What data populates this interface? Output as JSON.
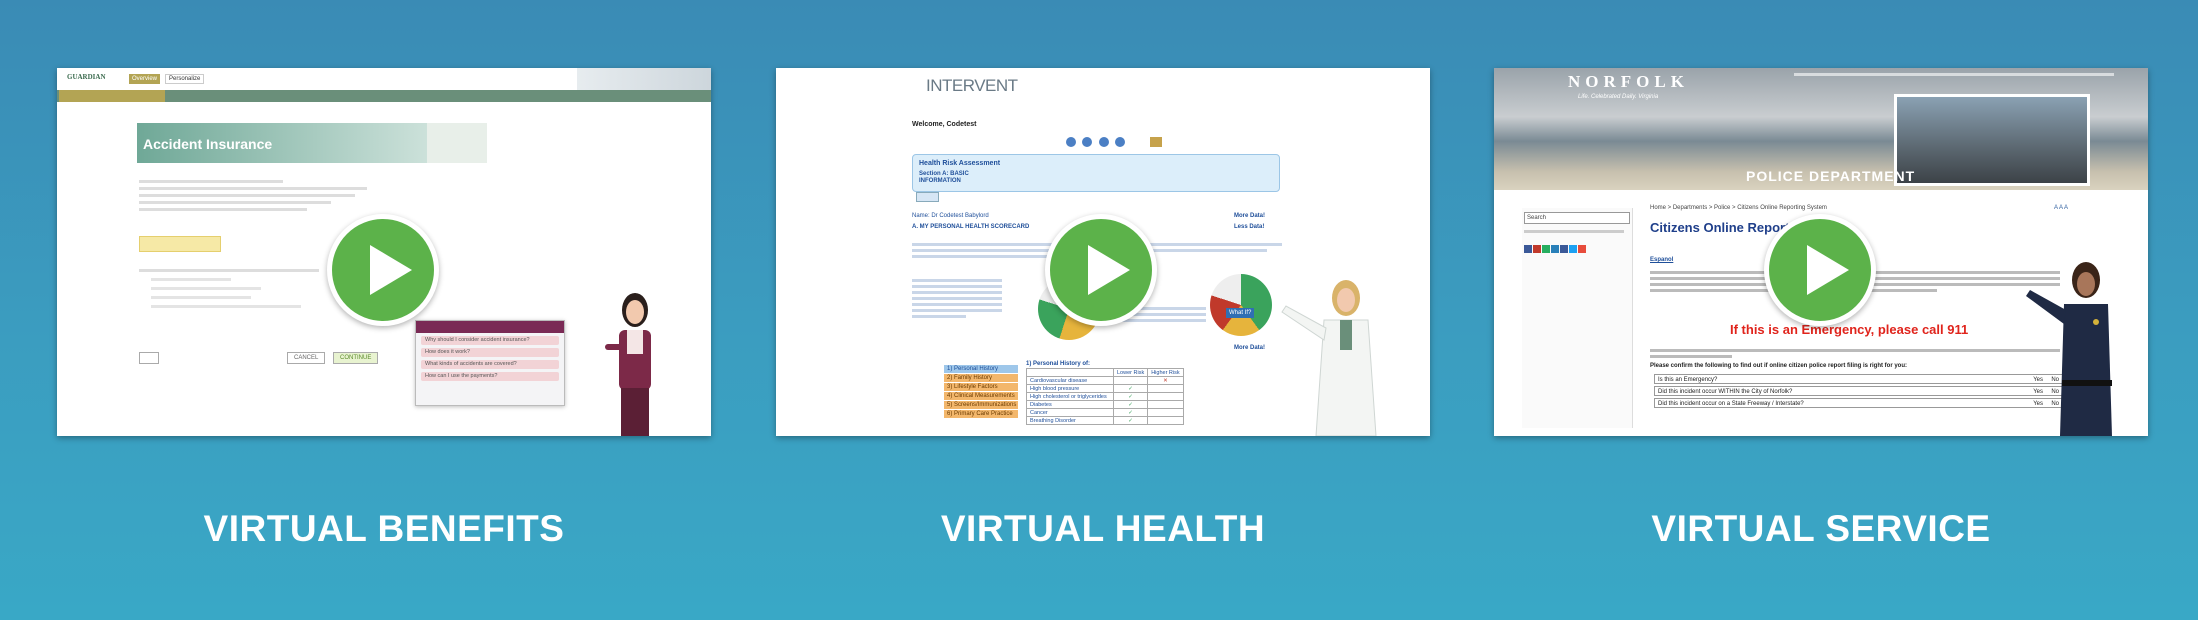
{
  "colors": {
    "band_top": "#3a8bb5",
    "band_bottom": "#39a8c6",
    "play": "#5cb24a",
    "caption": "#ffffff"
  },
  "cards": [
    {
      "caption": "VIRTUAL BENEFITS",
      "play_icon": "play-icon",
      "screen": {
        "logo": "GUARDIAN",
        "tabs": [
          "Overview",
          "Personalize"
        ],
        "subtabs": [
          "Accident Insurance"
        ],
        "panel_title": "Accident Insurance",
        "chat_items": [
          "Why should I consider accident insurance?",
          "How does it work?",
          "What kinds of accidents are covered?",
          "How can I use the payments?"
        ],
        "buttons": [
          "CANCEL",
          "CONTINUE"
        ]
      }
    },
    {
      "caption": "VIRTUAL HEALTH",
      "play_icon": "play-icon",
      "screen": {
        "logo": "INTERVENT",
        "welcome": "Welcome, Codetest",
        "box_title": "Health Risk Assessment",
        "box_sub1": "Section A: BASIC",
        "box_sub2": "INFORMATION",
        "name_line": "Name: Dr Codetest Babylord",
        "section": "A. MY PERSONAL HEALTH SCORECARD",
        "more": "More Data!",
        "less": "Less Data!",
        "history_title": "1) Personal History of:",
        "col_low": "Lower Risk",
        "col_high": "Higher Risk",
        "rows": [
          "Cardiovascular disease",
          "High blood pressure",
          "High cholesterol or triglycerides",
          "Diabetes",
          "Cancer",
          "Breathing Disorder"
        ],
        "tabs": [
          "1) Personal History",
          "2) Family History",
          "3) Lifestyle Factors",
          "4) Clinical Measurements",
          "5) Screens/Immunizations",
          "6) Primary Care Practice"
        ],
        "gauge_label": "What If?"
      }
    },
    {
      "caption": "VIRTUAL SERVICE",
      "play_icon": "play-icon",
      "screen": {
        "title": "NORFOLK",
        "tagline": "Life. Celebrated Daily. Virginia",
        "dept": "POLICE DEPARTMENT",
        "search": "Search",
        "breadcrumb": "Home > Departments > Police > Citizens Online Reporting System",
        "heading": "Citizens Online Report",
        "espanol": "Espanol",
        "emergency": "If this is an Emergency, please call 911",
        "confirm": "Please confirm the following to find out if online citizen police report filing is right for you:",
        "questions": [
          "Is this an Emergency?",
          "Did this incident occur WITHIN the City of Norfolk?",
          "Did this incident occur on a State Freeway / Interstate?"
        ],
        "yes": "Yes",
        "no": "No"
      }
    }
  ]
}
